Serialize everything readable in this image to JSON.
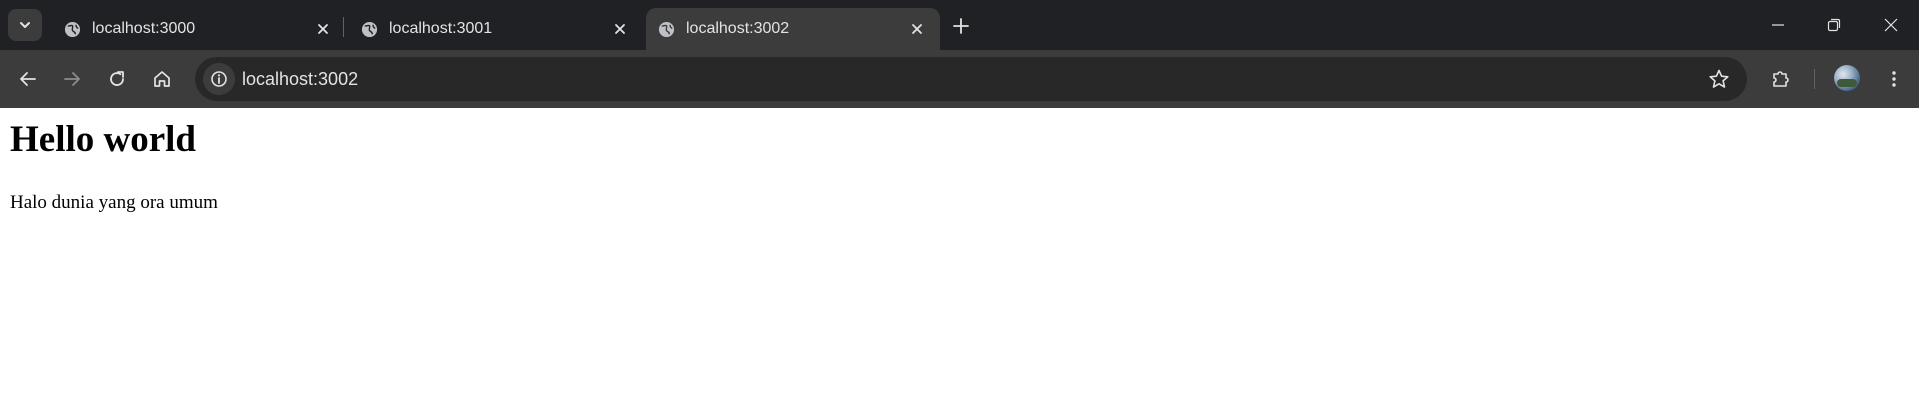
{
  "browser": {
    "tabs": [
      {
        "title": "localhost:3000",
        "icon": "globe-icon",
        "active": false
      },
      {
        "title": "localhost:3001",
        "icon": "globe-icon",
        "active": false
      },
      {
        "title": "localhost:3002",
        "icon": "globe-icon",
        "active": true
      }
    ],
    "address_bar": {
      "url": "localhost:3002"
    },
    "colors": {
      "tabstrip_bg": "#202124",
      "toolbar_bg": "#3c3c3c",
      "omnibox_bg": "#282828",
      "text": "#e3e3e3"
    }
  },
  "page": {
    "heading": "Hello world",
    "paragraph": "Halo dunia yang ora umum"
  }
}
